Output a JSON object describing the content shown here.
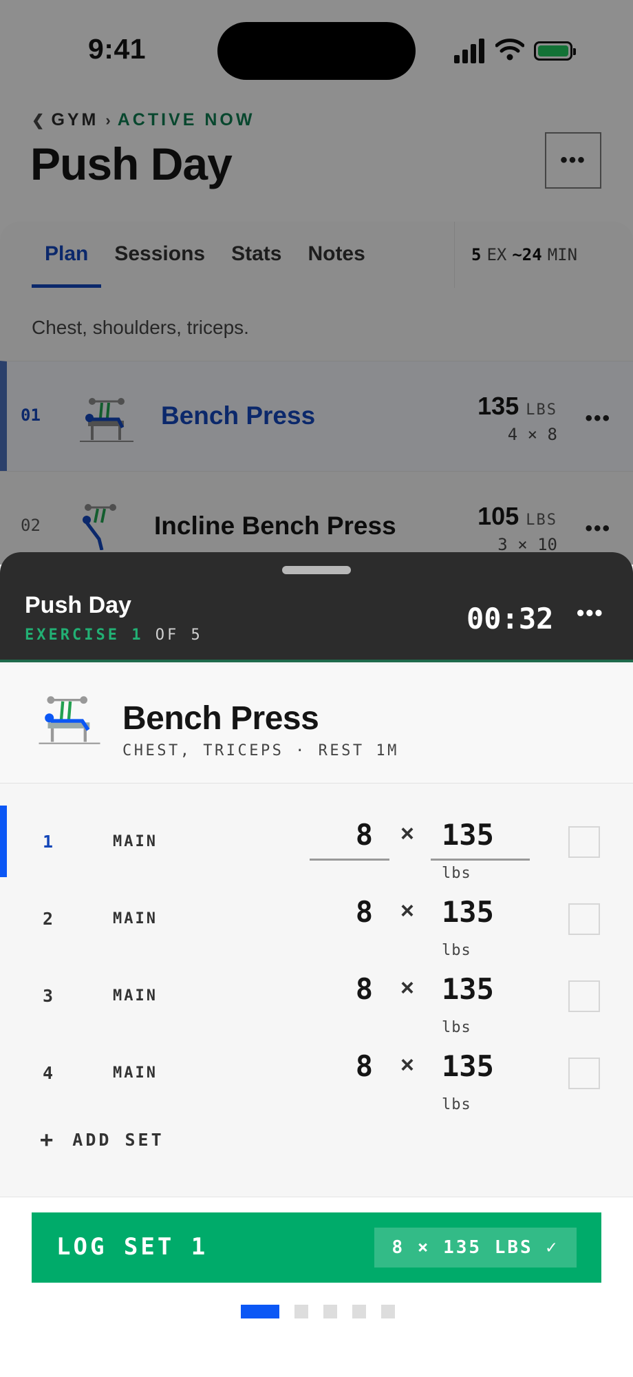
{
  "status_bar": {
    "time": "9:41"
  },
  "header": {
    "breadcrumb_parent": "GYM",
    "breadcrumb_current": "ACTIVE NOW",
    "title": "Push Day",
    "more_label": "•••"
  },
  "tabs": [
    {
      "label": "Plan",
      "active": true
    },
    {
      "label": "Sessions",
      "active": false
    },
    {
      "label": "Stats",
      "active": false
    },
    {
      "label": "Notes",
      "active": false
    }
  ],
  "tab_meta": {
    "exercise_count": "5",
    "exercise_unit": "EX",
    "duration": "~24",
    "duration_unit": "MIN"
  },
  "workout_description": "Chest, shoulders, triceps.",
  "exercise_list": [
    {
      "index": "01",
      "name": "Bench Press",
      "weight": "135",
      "unit": "LBS",
      "scheme": "4 × 8"
    },
    {
      "index": "02",
      "name": "Incline Bench Press",
      "weight": "105",
      "unit": "LBS",
      "scheme": "3 × 10"
    }
  ],
  "sheet": {
    "title": "Push Day",
    "exercise_prefix": "EXERCISE",
    "exercise_current": "1",
    "exercise_of": "OF 5",
    "timer": "00:32",
    "more_label": "•••"
  },
  "current_exercise": {
    "name": "Bench Press",
    "meta": "CHEST, TRICEPS · REST 1M"
  },
  "sets": [
    {
      "index": "1",
      "type": "MAIN",
      "reps": "8",
      "weight": "135",
      "unit": "lbs"
    },
    {
      "index": "2",
      "type": "MAIN",
      "reps": "8",
      "weight": "135",
      "unit": "lbs"
    },
    {
      "index": "3",
      "type": "MAIN",
      "reps": "8",
      "weight": "135",
      "unit": "lbs"
    },
    {
      "index": "4",
      "type": "MAIN",
      "reps": "8",
      "weight": "135",
      "unit": "lbs"
    }
  ],
  "times_symbol": "×",
  "add_set": {
    "icon": "+",
    "label": "ADD SET"
  },
  "log_button": {
    "label": "LOG SET 1",
    "summary": "8 × 135 LBS ✓"
  },
  "pager": {
    "total": 5,
    "current": 1
  },
  "colors": {
    "accent_blue": "#0b57f5",
    "accent_green": "#00ab6a",
    "sheet_header": "#2c2c2c"
  }
}
